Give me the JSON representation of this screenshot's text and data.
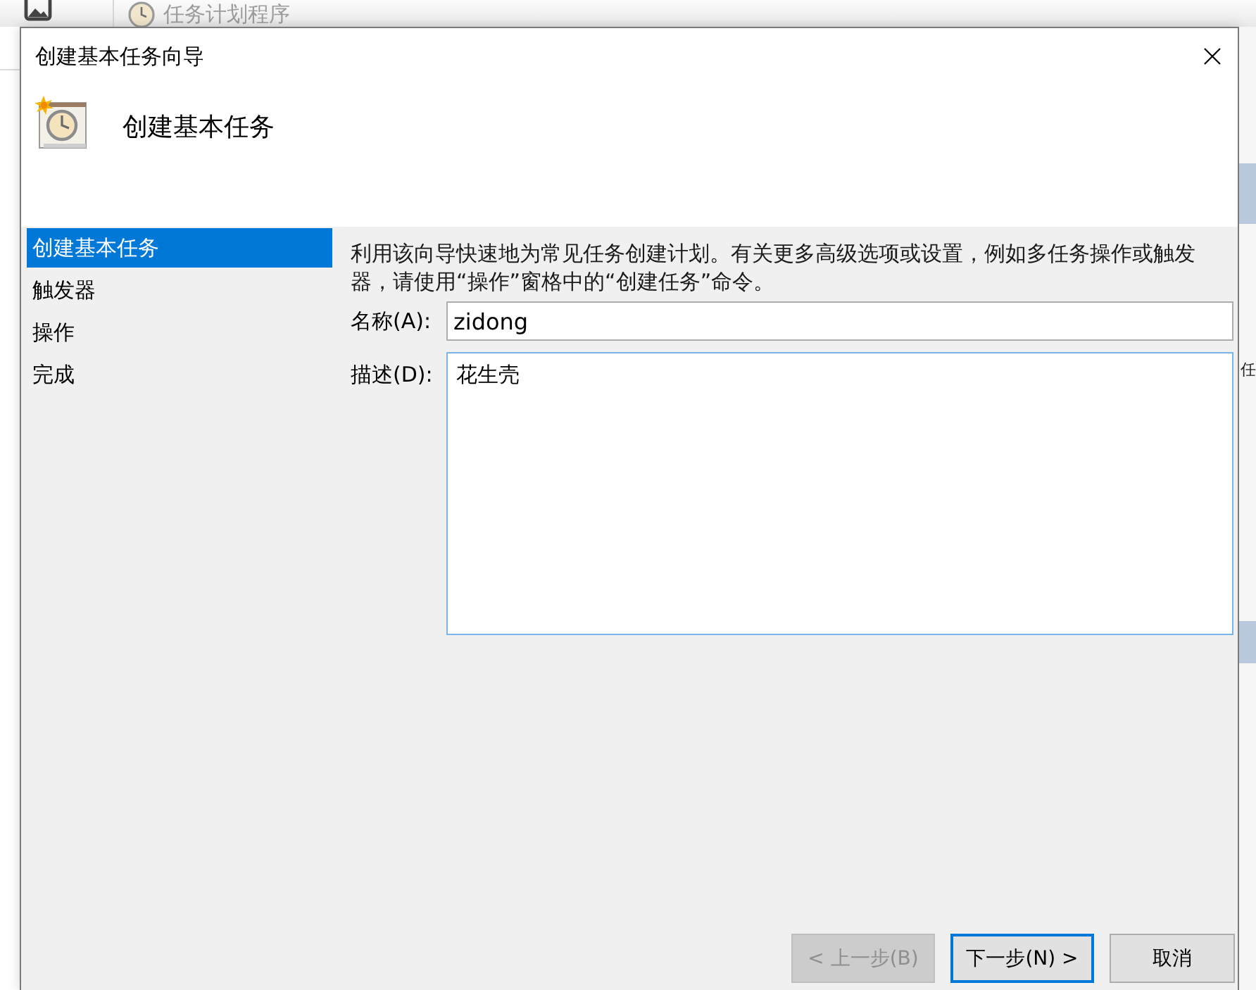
{
  "background_window": {
    "title": "任务计划程序",
    "side_text": "任"
  },
  "dialog": {
    "title": "创建基本任务向导",
    "heading": "创建基本任务"
  },
  "steps": [
    {
      "label": "创建基本任务",
      "selected": true
    },
    {
      "label": "触发器",
      "selected": false
    },
    {
      "label": "操作",
      "selected": false
    },
    {
      "label": "完成",
      "selected": false
    }
  ],
  "intro": "利用该向导快速地为常见任务创建计划。有关更多高级选项或设置，例如多任务操作或触发器，请使用“操作”窗格中的“创建任务”命令。",
  "fields": [
    {
      "kind": "line",
      "label": "名称(A):",
      "value": "zidong",
      "focused": false
    },
    {
      "kind": "multiline",
      "label": "描述(D):",
      "value": "花生壳",
      "focused": true
    }
  ],
  "buttons": [
    {
      "label": "< 上一步(B)",
      "disabled": true,
      "default": false
    },
    {
      "label": "下一步(N) >",
      "disabled": false,
      "default": true
    },
    {
      "label": "取消",
      "disabled": false,
      "default": false
    }
  ]
}
